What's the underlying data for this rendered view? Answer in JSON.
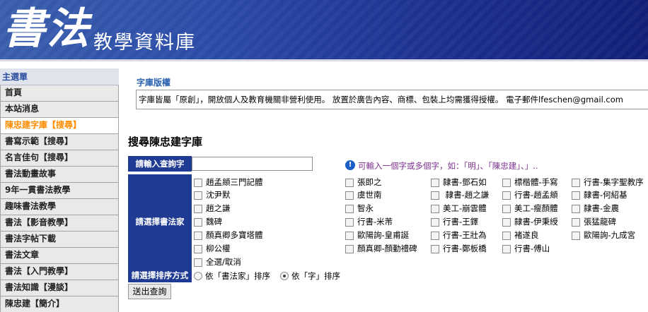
{
  "banner": {
    "logo_text": "書法",
    "subtitle": "教學資料庫"
  },
  "sidebar": {
    "header": "主選單",
    "items": [
      {
        "label": "首頁"
      },
      {
        "label": "本站消息"
      },
      {
        "label": "陳忠建字庫【搜尋】",
        "active": true
      },
      {
        "label": "書寫示範【搜尋】"
      },
      {
        "label": "名言佳句【搜尋】"
      },
      {
        "label": "書法動畫故事"
      },
      {
        "label": "9年一貫書法教學"
      },
      {
        "label": "趣味書法教學"
      },
      {
        "label": "書法【影音教學】"
      },
      {
        "label": "書法字帖下載"
      },
      {
        "label": "書法文章"
      },
      {
        "label": "書法【入門教學】"
      },
      {
        "label": "書法知識【漫談】"
      },
      {
        "label": "陳忠建【簡介】"
      }
    ]
  },
  "copyright": {
    "title": "字庫版權",
    "text": "字庫皆屬「原創」，開放個人及教育機關非營利使用。 放置於廣告內容、商標、包裝上均需獲得授權。 電子郵件lfeschen@gmail.com"
  },
  "search": {
    "title": "搜尋陳忠建字庫",
    "query_label": "請輸入查詢字",
    "query_value": "",
    "hint": "可輸入一個字或多個字，如：「明」、「陳忠建」、」..",
    "artist_label": "請選擇書法家",
    "sort_label": "請選擇排序方式",
    "submit_label": "送出查詢",
    "artist_columns": [
      [
        "趙孟頫三門記體",
        "沈尹默",
        "趙之謙",
        "魏碑",
        "顏真卿多寶塔體",
        "柳公權",
        "全選/取消"
      ],
      [
        "張即之",
        "虞世南",
        "智永",
        "行書-米芾",
        "歐陽詢-皇甫誕",
        "顏真卿-顏勤禮碑"
      ],
      [
        "隸書-鄧石如",
        " 隸書-趙之謙",
        "美工-崩雲體",
        "行書-王鐸",
        "行書-王壯為",
        "行書-鄭板橋"
      ],
      [
        "標楷體-手寫",
        "行書-趙孟頫",
        "美工-瘦顏體",
        "隸書-伊秉綬",
        "褚遂良",
        "行書-傅山"
      ],
      [
        "行書-集字聖教序",
        "隸書-何紹基",
        "隸書-金農",
        "張猛龍碑",
        "歐陽詢-九成宮"
      ]
    ],
    "sort_options": [
      {
        "label": "依「書法家」排序",
        "selected": false
      },
      {
        "label": "依「字」排序",
        "selected": true
      }
    ]
  }
}
